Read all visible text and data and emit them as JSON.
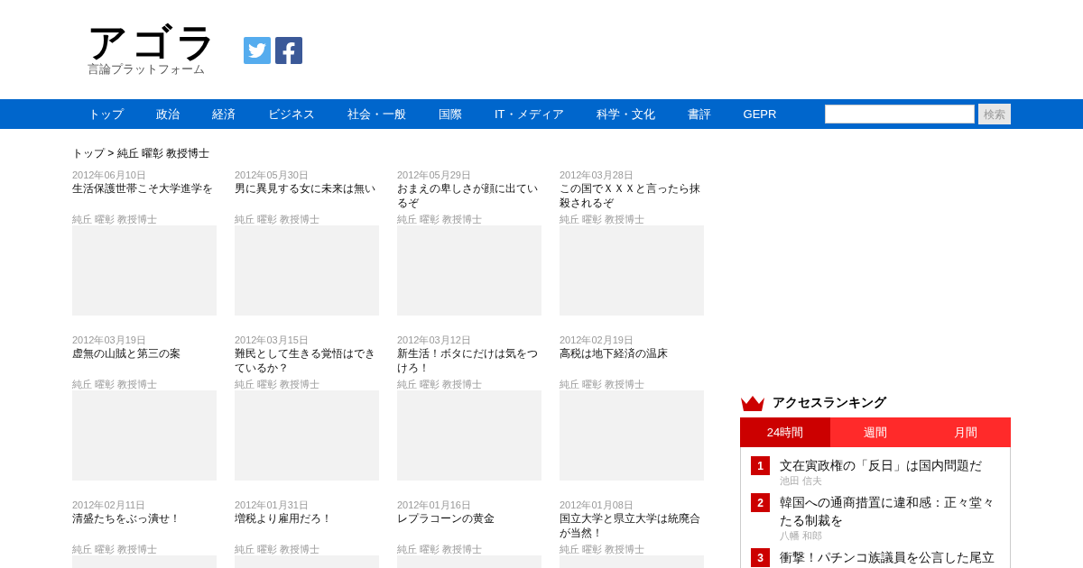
{
  "logo": {
    "title": "アゴラ",
    "subtitle": "言論プラットフォーム"
  },
  "nav": {
    "items": [
      {
        "label": "トップ"
      },
      {
        "label": "政治"
      },
      {
        "label": "経済"
      },
      {
        "label": "ビジネス"
      },
      {
        "label": "社会・一般"
      },
      {
        "label": "国際"
      },
      {
        "label": "IT・メディア"
      },
      {
        "label": "科学・文化"
      },
      {
        "label": "書評"
      },
      {
        "label": "GEPR"
      }
    ],
    "search_button": "検索"
  },
  "breadcrumb": "トップ > 純丘 曜彰 教授博士",
  "articles": [
    {
      "date": "2012年06月10日",
      "title": "生活保護世帯こそ大学進学を",
      "author": "純丘 曜彰 教授博士"
    },
    {
      "date": "2012年05月30日",
      "title": "男に異見する女に未来は無い",
      "author": "純丘 曜彰 教授博士"
    },
    {
      "date": "2012年05月29日",
      "title": "おまえの卑しさが顔に出ているぞ",
      "author": "純丘 曜彰 教授博士"
    },
    {
      "date": "2012年03月28日",
      "title": "この国でＸＸＸと言ったら抹殺されるぞ",
      "author": "純丘 曜彰 教授博士"
    },
    {
      "date": "2012年03月19日",
      "title": "虚無の山賊と第三の案",
      "author": "純丘 曜彰 教授博士"
    },
    {
      "date": "2012年03月15日",
      "title": "難民として生きる覚悟はできているか？",
      "author": "純丘 曜彰 教授博士"
    },
    {
      "date": "2012年03月12日",
      "title": "新生活！ボタにだけは気をつけろ！",
      "author": "純丘 曜彰 教授博士"
    },
    {
      "date": "2012年02月19日",
      "title": "高税は地下経済の温床",
      "author": "純丘 曜彰 教授博士"
    },
    {
      "date": "2012年02月11日",
      "title": "清盛たちをぶっ潰せ！",
      "author": "純丘 曜彰 教授博士"
    },
    {
      "date": "2012年01月31日",
      "title": "増税より雇用だろ！",
      "author": "純丘 曜彰 教授博士"
    },
    {
      "date": "2012年01月16日",
      "title": "レプラコーンの黄金",
      "author": "純丘 曜彰 教授博士"
    },
    {
      "date": "2012年01月08日",
      "title": "国立大学と県立大学は統廃合が当然！",
      "author": "純丘 曜彰 教授博士"
    }
  ],
  "ranking": {
    "title": "アクセスランキング",
    "tabs": [
      {
        "label": "24時間",
        "selected": true
      },
      {
        "label": "週間",
        "selected": false
      },
      {
        "label": "月間",
        "selected": false
      }
    ],
    "items": [
      {
        "rank": "1",
        "title": "文在寅政権の「反日」は国内問題だ",
        "author": "池田 信夫"
      },
      {
        "rank": "2",
        "title": "韓国への通商措置に違和感：正々堂々たる制裁を",
        "author": "八幡 和郎"
      },
      {
        "rank": "3",
        "title": "衝撃！パチンコ族議員を公言した尾立"
      }
    ]
  }
}
